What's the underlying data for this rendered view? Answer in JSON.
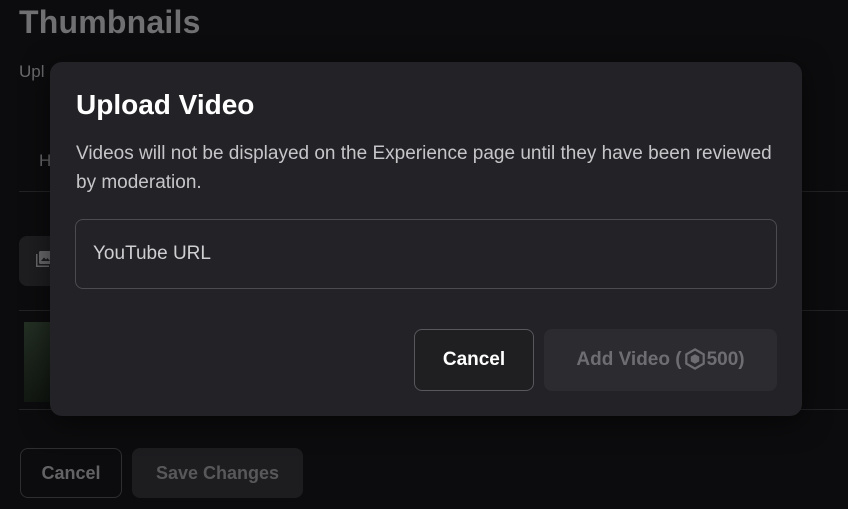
{
  "background": {
    "title": "Thumbnails",
    "subtitle_visible": "Upl",
    "tab_visible": "H",
    "cancel_label": "Cancel",
    "save_label": "Save Changes"
  },
  "modal": {
    "title": "Upload Video",
    "description": "Videos will not be displayed on the Experience page until they have been reviewed by moderation.",
    "url_input": {
      "placeholder": "YouTube URL",
      "value": ""
    },
    "cancel_label": "Cancel",
    "add_video": {
      "prefix": "Add Video (",
      "cost": "500",
      "suffix": ")",
      "currency_icon": "robux-icon"
    }
  },
  "colors": {
    "modal_bg": "#232327",
    "page_bg": "#0c0c0e",
    "primary_text": "#ffffff",
    "disabled_text": "#6e6e72"
  }
}
